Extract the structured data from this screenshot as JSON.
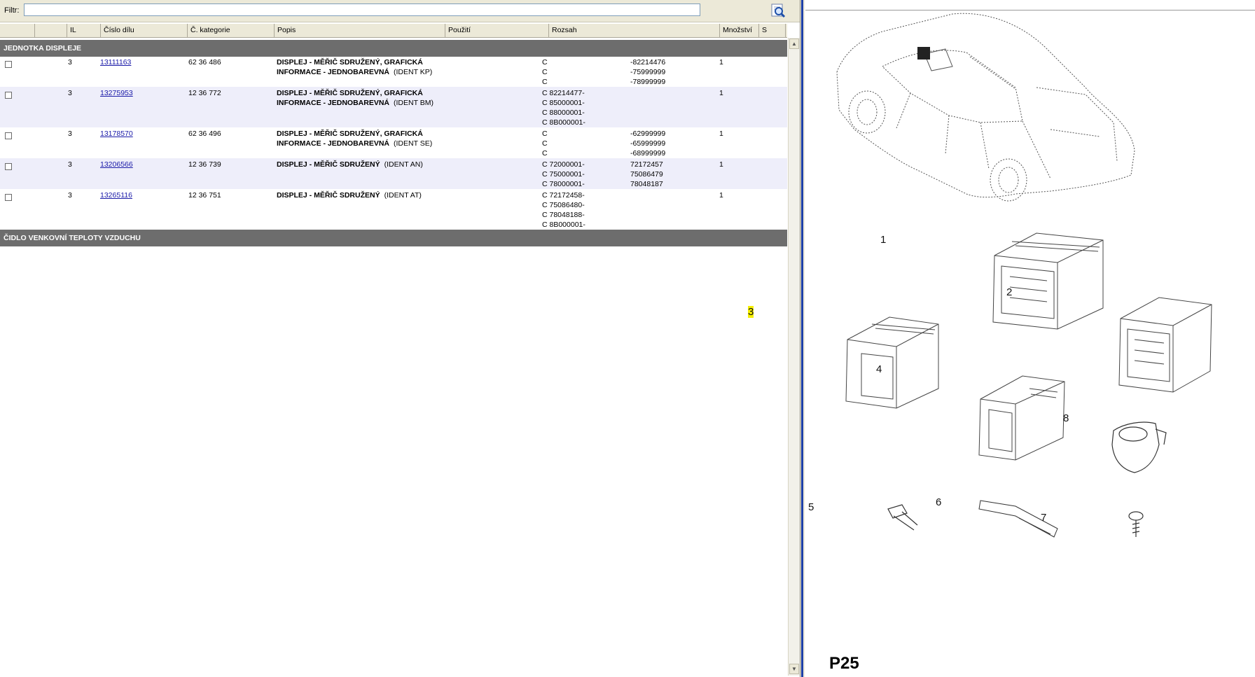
{
  "filter": {
    "label": "Filtr:",
    "value": "",
    "search_icon": "search-magnifier-icon"
  },
  "columns": [
    "",
    "",
    "IL",
    "Číslo dílu",
    "Č. kategorie",
    "Popis",
    "Použití",
    "Rozsah",
    "Množství",
    "S"
  ],
  "groups": [
    {
      "title": "JEDNOTKA DISPLEJE"
    },
    {
      "title": "ČIDLO VENKOVNÍ TEPLOTY VZDUCHU"
    }
  ],
  "rows": [
    {
      "il": "3",
      "part": "13111163",
      "cat": "62 36 486",
      "desc1": "DISPLEJ - MĚŘIČ SDRUŽENÝ, GRAFICKÁ",
      "desc2": "INFORMACE - JEDNOBAREVNÁ",
      "ident": "(IDENT KP)",
      "r1": [
        "C",
        "C",
        "C"
      ],
      "r2": [
        "-82214476",
        "-75999999",
        "-78999999"
      ],
      "qty": "1"
    },
    {
      "il": "3",
      "part": "13275953",
      "cat": "12 36 772",
      "desc1": "DISPLEJ - MĚŘIČ SDRUŽENÝ, GRAFICKÁ",
      "desc2": "INFORMACE - JEDNOBAREVNÁ",
      "ident": "(IDENT BM)",
      "r1": [
        "C 82214477-",
        "C 85000001-",
        "C 88000001-",
        "C 8B000001-"
      ],
      "r2": [],
      "qty": "1"
    },
    {
      "il": "3",
      "part": "13178570",
      "cat": "62 36 496",
      "desc1": "DISPLEJ - MĚŘIČ SDRUŽENÝ, GRAFICKÁ",
      "desc2": "INFORMACE - JEDNOBAREVNÁ",
      "ident": "(IDENT SE)",
      "r1": [
        "C",
        "C",
        "C"
      ],
      "r2": [
        "-62999999",
        "-65999999",
        "-68999999"
      ],
      "qty": "1"
    },
    {
      "il": "3",
      "part": "13206566",
      "cat": "12 36 739",
      "desc1": "DISPLEJ - MĚŘIČ SDRUŽENÝ",
      "desc2": "",
      "ident": "(IDENT AN)",
      "r1": [
        "C 72000001-",
        "C 75000001-",
        "C 78000001-"
      ],
      "r2": [
        "72172457",
        "75086479",
        "78048187"
      ],
      "qty": "1"
    },
    {
      "il": "3",
      "part": "13265116",
      "cat": "12 36 751",
      "desc1": "DISPLEJ - MĚŘIČ SDRUŽENÝ",
      "desc2": "",
      "ident": "(IDENT AT)",
      "r1": [
        "C 72172458-",
        "C 75086480-",
        "C 78048188-",
        "C 8B000001-"
      ],
      "r2": [],
      "qty": "1"
    }
  ],
  "diagram": {
    "labels": [
      "1",
      "2",
      "3",
      "4",
      "5",
      "6",
      "7",
      "8"
    ],
    "highlighted_label": "3",
    "highlight_color": "#f5ef00",
    "ref_code": "P25"
  }
}
